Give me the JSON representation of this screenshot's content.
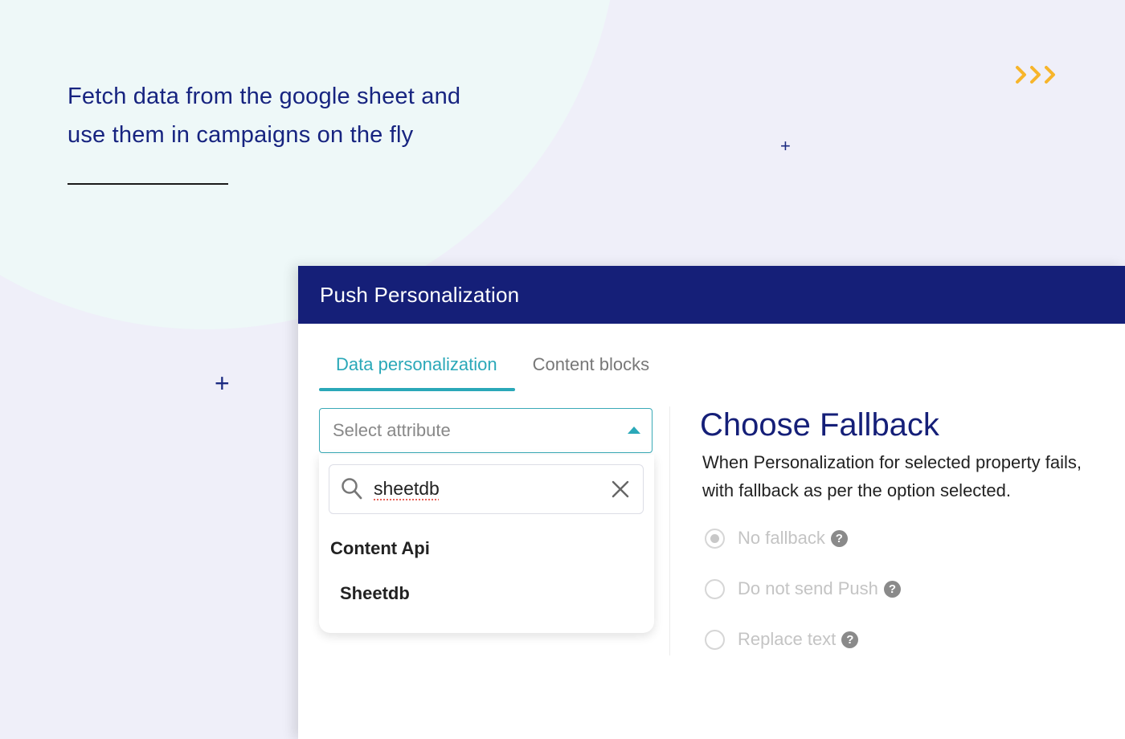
{
  "hero": {
    "text_line1": "Fetch data from the google sheet and",
    "text_line2": "use them in campaigns on the fly"
  },
  "decor": {
    "plus_glyph": "+",
    "chevrons_icon": "triple-chevron-right-icon",
    "chevron_color": "#f7b52b"
  },
  "panel": {
    "title": "Push Personalization",
    "header_color": "#151f78",
    "tabs": [
      {
        "label": "Data personalization",
        "active": true
      },
      {
        "label": "Content blocks",
        "active": false
      }
    ],
    "accent_color": "#2aa8b8",
    "select": {
      "placeholder": "Select attribute",
      "caret_icon": "caret-up-icon"
    },
    "dropdown": {
      "search": {
        "value": "sheetdb",
        "search_icon": "search-icon",
        "clear_icon": "close-icon"
      },
      "group_label": "Content Api",
      "options": [
        "Sheetdb"
      ]
    },
    "fallback": {
      "title": "Choose Fallback",
      "desc_line1": "When Personalization for selected property fails,",
      "desc_line2": "with fallback as per the option selected.",
      "options": [
        {
          "label": "No fallback",
          "checked": true,
          "help": "?"
        },
        {
          "label": "Do not send Push",
          "checked": false,
          "help": "?"
        },
        {
          "label": "Replace text",
          "checked": false,
          "help": "?"
        }
      ]
    }
  }
}
